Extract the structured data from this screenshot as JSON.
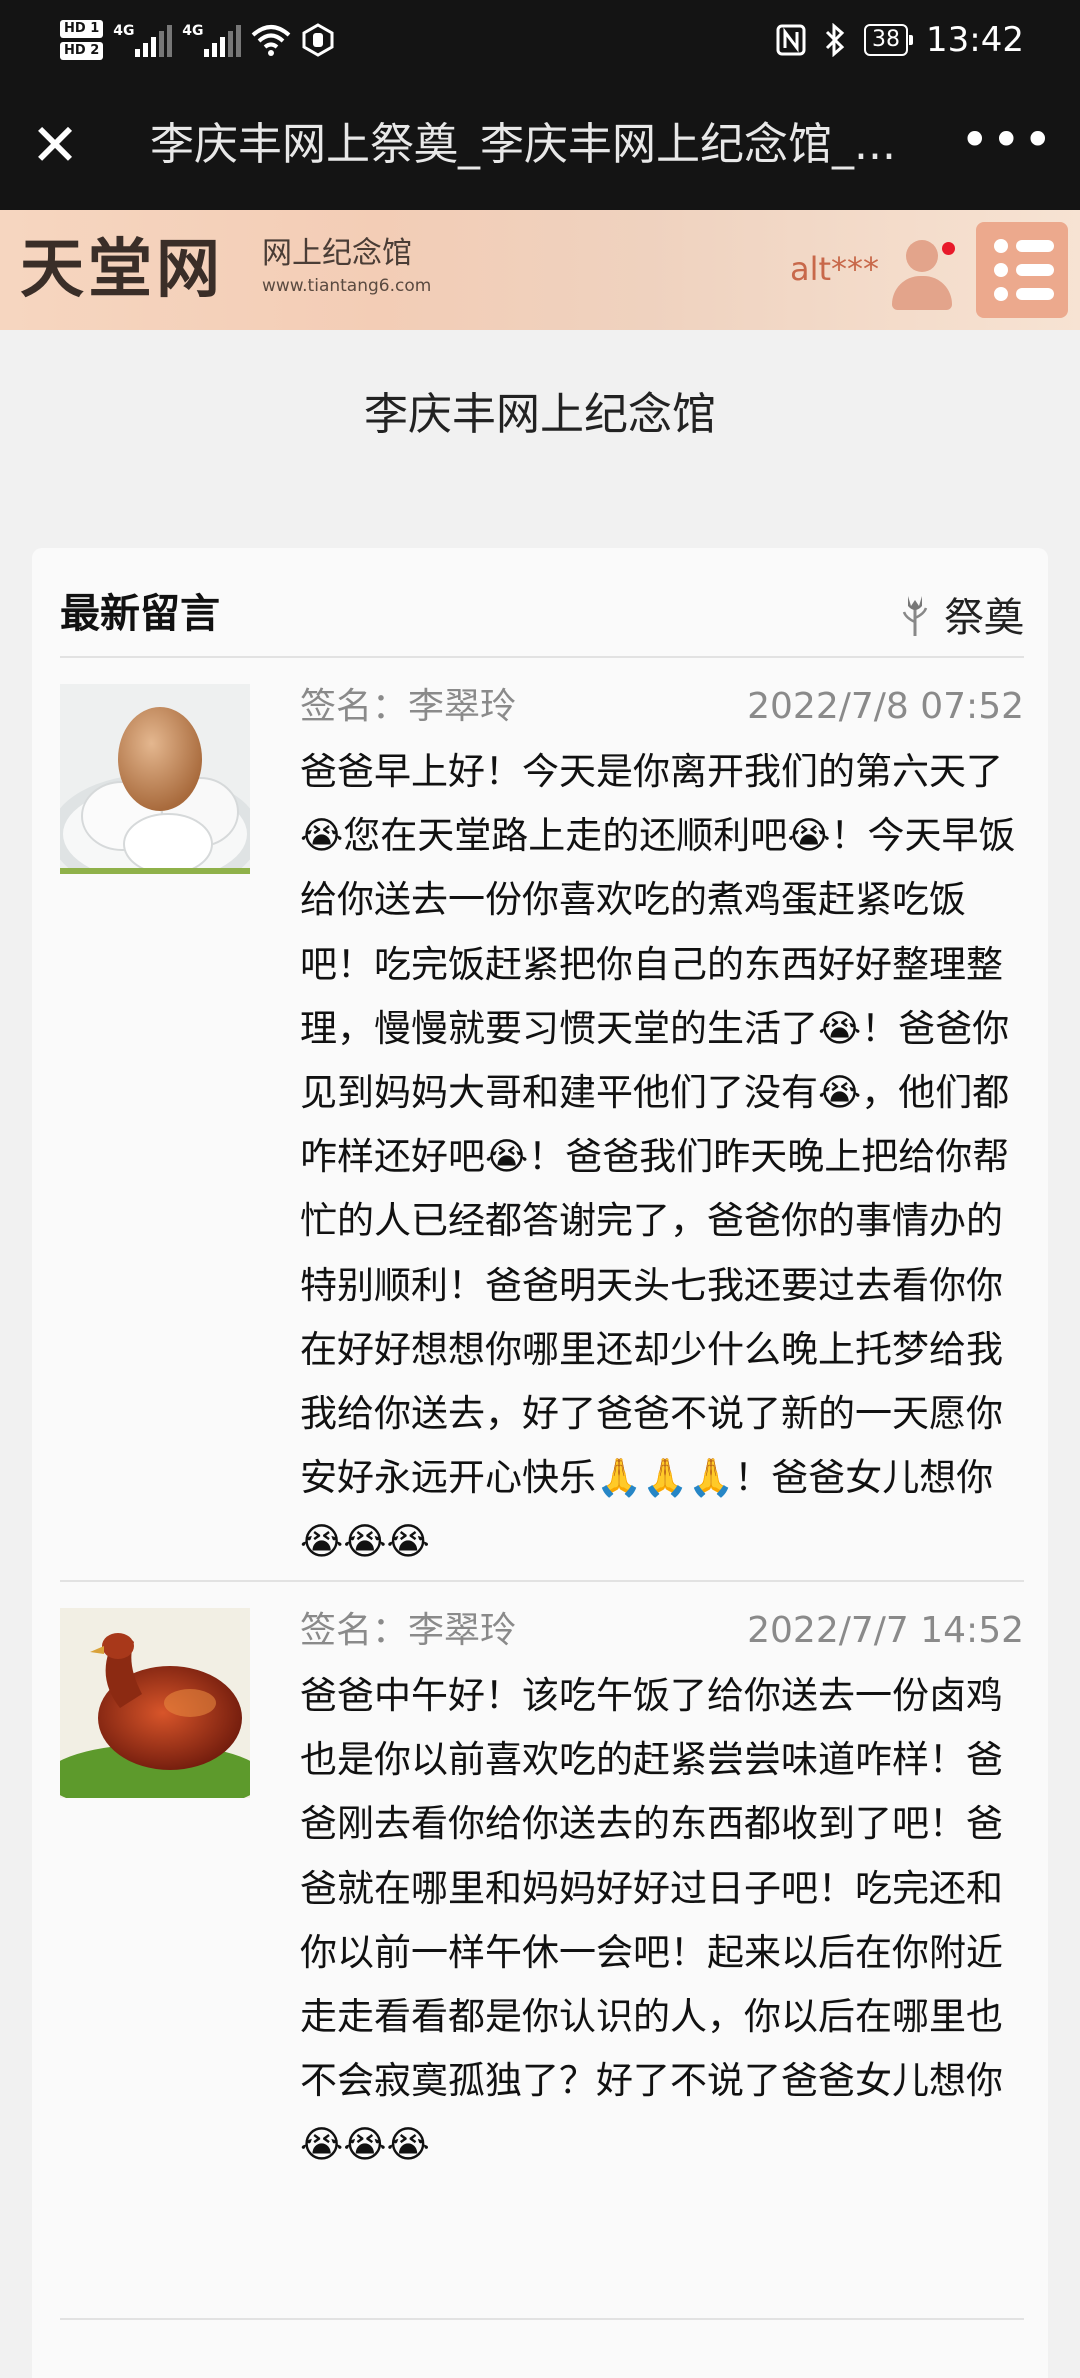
{
  "status_bar": {
    "hd1": "HD 1",
    "hd2": "HD 2",
    "net1": "4G",
    "net2": "4G",
    "battery": "38",
    "time": "13:42",
    "icons": [
      "nfc-icon",
      "bluetooth-icon",
      "wifi-icon",
      "battery-icon"
    ]
  },
  "titlebar": {
    "close_label": "✕",
    "title": "李庆丰网上祭奠_李庆丰网上纪念馆_...",
    "more_label": "•••"
  },
  "site": {
    "logo_main": "天堂网",
    "logo_sub": "网上纪念馆",
    "logo_url": "www.tiantang6.com",
    "username": "alt***"
  },
  "page_title": "李庆丰网上纪念馆",
  "card": {
    "title": "最新留言",
    "memorial_label": "祭奠"
  },
  "messages": [
    {
      "sign": "签名：李翠玲",
      "time": "2022/7/8 07:52",
      "avatar": "boiled-eggs-photo",
      "body": "爸爸早上好！今天是你离开我们的第六天了😭您在天堂路上走的还顺利吧😭！今天早饭给你送去一份你喜欢吃的煮鸡蛋赶紧吃饭吧！吃完饭赶紧把你自己的东西好好整理整理，慢慢就要习惯天堂的生活了😭！爸爸你见到妈妈大哥和建平他们了没有😭，他们都咋样还好吧😭！爸爸我们昨天晚上把给你帮忙的人已经都答谢完了，爸爸你的事情办的特别顺利！爸爸明天头七我还要过去看你你在好好想想你哪里还却少什么晚上托梦给我我给你送去，好了爸爸不说了新的一天愿你安好永远开心快乐🙏🙏🙏！爸爸女儿想你😭😭😭"
    },
    {
      "sign": "签名：李翠玲",
      "time": "2022/7/7 14:52",
      "avatar": "braised-chicken-photo",
      "body": "爸爸中午好！该吃午饭了给你送去一份卤鸡也是你以前喜欢吃的赶紧尝尝味道咋样！爸爸刚去看你给你送去的东西都收到了吧！爸爸就在哪里和妈妈好好过日子吧！吃完还和你以前一样午休一会吧！起来以后在你附近走走看看都是你认识的人，你以后在哪里也不会寂寞孤独了？好了不说了爸爸女儿想你😭😭😭"
    }
  ],
  "colors": {
    "bar_bg": "#141414",
    "header_bg": "#f3cdb6",
    "accent": "#c8684a",
    "menu_bg": "#eca98d",
    "notify_dot": "#e8192a"
  }
}
